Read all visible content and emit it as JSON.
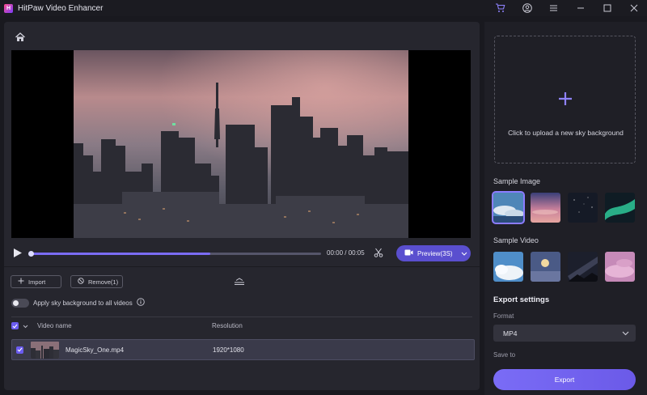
{
  "app": {
    "title": "HitPaw Video Enhancer",
    "logo_letter": "H"
  },
  "player": {
    "current_time": "00:00",
    "duration": "00:05",
    "time_text": "00:00 / 00:05",
    "progress_fraction": 0.62,
    "preview_label": "Preview(3S)"
  },
  "toolbar": {
    "import_label": "Import",
    "remove_label": "Remove(1)"
  },
  "apply_sky": {
    "label": "Apply sky background to all videos",
    "enabled": false
  },
  "table": {
    "headers": [
      "Video name",
      "Resolution"
    ],
    "rows": [
      {
        "name": "MagicSky_One.mp4",
        "resolution": "1920*1080",
        "checked": true
      }
    ]
  },
  "sidebar": {
    "upload_text": "Click to upload a new sky background",
    "sample_image_label": "Sample Image",
    "sample_video_label": "Sample Video",
    "sample_images": [
      "sky-clouds-blue",
      "sky-sunset-pink",
      "sky-night-stars",
      "sky-aurora-green"
    ],
    "sample_videos": [
      "sky-cumulus-blue",
      "sky-moon-dusk",
      "sky-milky-way",
      "sky-pink-clouds"
    ],
    "selected_sample_image": 0
  },
  "export": {
    "title": "Export settings",
    "format_label": "Format",
    "format_value": "MP4",
    "save_to_label": "Save to",
    "button_label": "Export"
  },
  "colors": {
    "accent": "#6b5cf0",
    "preview_button": "#5a4fcf",
    "background": "#19191f",
    "panel": "#26262e"
  }
}
